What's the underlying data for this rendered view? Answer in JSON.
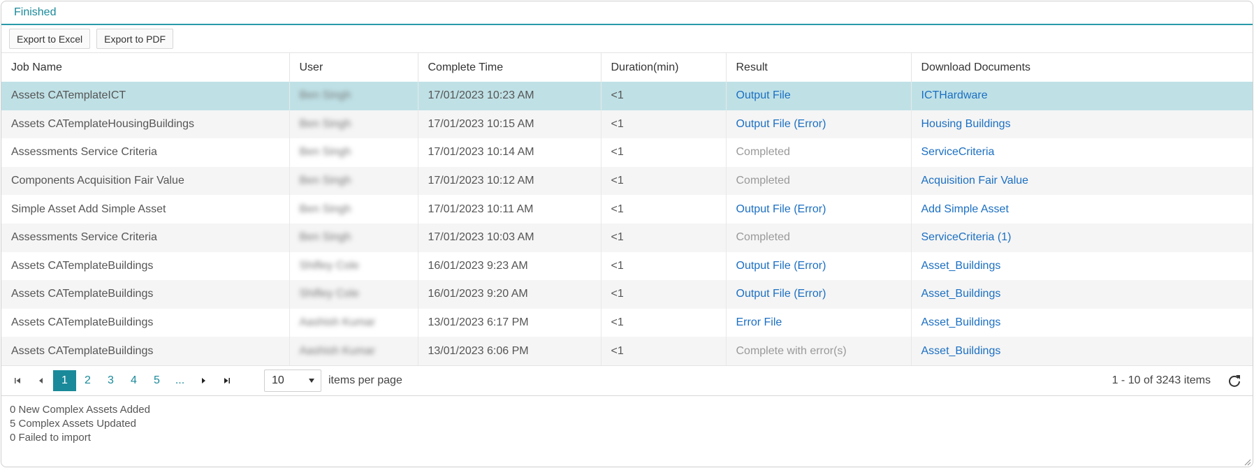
{
  "panel": {
    "title": "Finished"
  },
  "toolbar": {
    "export_excel": "Export to Excel",
    "export_pdf": "Export to PDF"
  },
  "columns": [
    "Job Name",
    "User",
    "Complete Time",
    "Duration(min)",
    "Result",
    "Download Documents"
  ],
  "rows": [
    {
      "job": "Assets CATemplateICT",
      "user": "Ben Singh",
      "time": "17/01/2023 10:23 AM",
      "duration": "<1",
      "result": "Output File",
      "result_link": true,
      "doc": "ICTHardware"
    },
    {
      "job": "Assets CATemplateHousingBuildings",
      "user": "Ben Singh",
      "time": "17/01/2023 10:15 AM",
      "duration": "<1",
      "result": "Output File (Error)",
      "result_link": true,
      "doc": "Housing Buildings"
    },
    {
      "job": "Assessments Service Criteria",
      "user": "Ben Singh",
      "time": "17/01/2023 10:14 AM",
      "duration": "<1",
      "result": "Completed",
      "result_link": false,
      "doc": "ServiceCriteria"
    },
    {
      "job": "Components Acquisition Fair Value",
      "user": "Ben Singh",
      "time": "17/01/2023 10:12 AM",
      "duration": "<1",
      "result": "Completed",
      "result_link": false,
      "doc": "Acquisition Fair Value"
    },
    {
      "job": "Simple Asset Add Simple Asset",
      "user": "Ben Singh",
      "time": "17/01/2023 10:11 AM",
      "duration": "<1",
      "result": "Output File (Error)",
      "result_link": true,
      "doc": "Add Simple Asset"
    },
    {
      "job": "Assessments Service Criteria",
      "user": "Ben Singh",
      "time": "17/01/2023 10:03 AM",
      "duration": "<1",
      "result": "Completed",
      "result_link": false,
      "doc": "ServiceCriteria (1)"
    },
    {
      "job": "Assets CATemplateBuildings",
      "user": "Shifley Cole",
      "time": "16/01/2023 9:23 AM",
      "duration": "<1",
      "result": "Output File (Error)",
      "result_link": true,
      "doc": "Asset_Buildings"
    },
    {
      "job": "Assets CATemplateBuildings",
      "user": "Shifley Cole",
      "time": "16/01/2023 9:20 AM",
      "duration": "<1",
      "result": "Output File (Error)",
      "result_link": true,
      "doc": "Asset_Buildings"
    },
    {
      "job": "Assets CATemplateBuildings",
      "user": "Aashish Kumar",
      "time": "13/01/2023 6:17 PM",
      "duration": "<1",
      "result": "Error File",
      "result_link": true,
      "doc": "Asset_Buildings"
    },
    {
      "job": "Assets CATemplateBuildings",
      "user": "Aashish Kumar",
      "time": "13/01/2023 6:06 PM",
      "duration": "<1",
      "result": "Complete with error(s)",
      "result_link": false,
      "doc": "Asset_Buildings"
    }
  ],
  "pager": {
    "pages": [
      "1",
      "2",
      "3",
      "4",
      "5",
      "..."
    ],
    "current": "1",
    "page_size": "10",
    "items_label": "items per page",
    "info": "1 - 10 of 3243 items"
  },
  "log": [
    "0 New Complex Assets Added",
    "5 Complex Assets Updated",
    "0 Failed to import"
  ],
  "colors": {
    "accent": "#1a8a9a",
    "link": "#1b6fc2",
    "selected_row": "#bfe1e6"
  },
  "icons": [
    "first-page-icon",
    "prev-page-icon",
    "next-page-icon",
    "last-page-icon",
    "dropdown-caret-icon",
    "refresh-icon",
    "resize-grip-icon"
  ]
}
